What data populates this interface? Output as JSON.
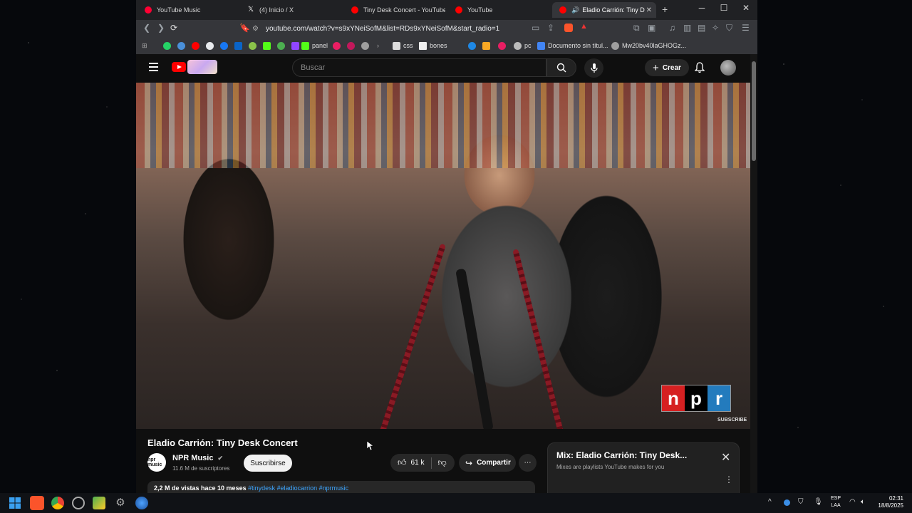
{
  "browser": {
    "tabs": [
      {
        "label": "YouTube Music",
        "active": false,
        "icon": "youtube-music-icon"
      },
      {
        "label": "(4) Inicio / X",
        "active": false,
        "icon": "x-icon"
      },
      {
        "label": "Tiny Desk Concert - YouTube",
        "active": false,
        "icon": "youtube-icon"
      },
      {
        "label": "YouTube",
        "active": false,
        "icon": "youtube-icon"
      },
      {
        "label": "Eladio Carrión: Tiny Desk",
        "active": true,
        "icon": "youtube-icon"
      }
    ],
    "url": "youtube.com/watch?v=s9xYNeiSofM&list=RDs9xYNeiSofM&start_radio=1",
    "bookmarks": [
      "panel",
      "css",
      "bones",
      "pc",
      "Documento sin títul...",
      "Mw20bv40laGHOGz..."
    ]
  },
  "youtube": {
    "search_placeholder": "Buscar",
    "create_label": "Crear",
    "video_title": "Eladio Carrión: Tiny Desk Concert",
    "channel_name": "NPR Music",
    "channel_avatar_text": "npr music",
    "subscribers": "11.6 M de suscriptores",
    "subscribe_label": "Suscribirse",
    "likes": "61 k",
    "share_label": "Compartir",
    "description_meta": "2,2 M de vistas  hace 10 meses",
    "description_tags": "#tinydesk #eladiocarrion #nprmusic",
    "npr_logo": [
      "n",
      "p",
      "r"
    ],
    "watermark": "SUBSCRIBE",
    "mix": {
      "title": "Mix: Eladio Carrión: Tiny Desk...",
      "subtitle": "Mixes are playlists YouTube makes for you"
    }
  },
  "taskbar": {
    "lang_line1": "ESP",
    "lang_line2": "LAA",
    "time": "02:31",
    "date": "18/8/2025"
  },
  "colors": {
    "youtube_red": "#ff0000",
    "link_blue": "#3ea6ff",
    "npr_red": "#d62021",
    "npr_black": "#000000",
    "npr_blue": "#237bbd"
  }
}
